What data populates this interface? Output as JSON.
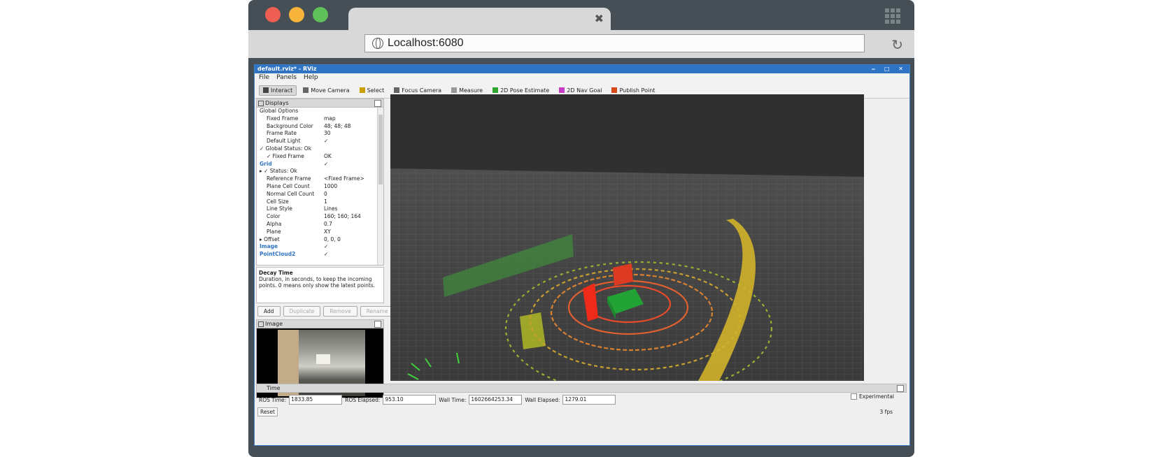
{
  "browser": {
    "address": "Localhost:6080",
    "tab_close": "✖",
    "reload": "↻"
  },
  "rviz": {
    "title": "default.rviz* - RViz",
    "window_buttons": "‒ □ ✕",
    "menu": [
      "File",
      "Panels",
      "Help"
    ],
    "toolbar": [
      {
        "label": "Interact",
        "icon": "hand-icon",
        "color": "#444"
      },
      {
        "label": "Move Camera",
        "icon": "move-camera-icon",
        "color": "#666"
      },
      {
        "label": "Select",
        "icon": "select-icon",
        "color": "#c8a000"
      },
      {
        "label": "Focus Camera",
        "icon": "focus-camera-icon",
        "color": "#666"
      },
      {
        "label": "Measure",
        "icon": "measure-icon",
        "color": "#999"
      },
      {
        "label": "2D Pose Estimate",
        "icon": "pose-estimate-icon",
        "color": "#2fa52f"
      },
      {
        "label": "2D Nav Goal",
        "icon": "nav-goal-icon",
        "color": "#c83cc8"
      },
      {
        "label": "Publish Point",
        "icon": "publish-point-icon",
        "color": "#d94a1a"
      }
    ],
    "displays": {
      "header": "Displays",
      "rows": [
        {
          "k": "Global Options",
          "v": "",
          "indent": 4,
          "color": "#222"
        },
        {
          "k": "Fixed Frame",
          "v": "map",
          "indent": 14,
          "color": "#222"
        },
        {
          "k": "Background Color",
          "v": "48; 48; 48",
          "indent": 14,
          "color": "#222"
        },
        {
          "k": "Frame Rate",
          "v": "30",
          "indent": 14,
          "color": "#222"
        },
        {
          "k": "Default Light",
          "v": "✓",
          "indent": 14,
          "color": "#222"
        },
        {
          "k": "✓ Global Status: Ok",
          "v": "",
          "indent": 4,
          "color": "#222"
        },
        {
          "k": "✓ Fixed Frame",
          "v": "OK",
          "indent": 14,
          "color": "#222"
        },
        {
          "k": "Grid",
          "v": "✓",
          "indent": 4,
          "color": "#2f73c4"
        },
        {
          "k": "▸ ✓ Status: Ok",
          "v": "",
          "indent": 4,
          "color": "#222"
        },
        {
          "k": "Reference Frame",
          "v": "<Fixed Frame>",
          "indent": 14,
          "color": "#222"
        },
        {
          "k": "Plane Cell Count",
          "v": "1000",
          "indent": 14,
          "color": "#222"
        },
        {
          "k": "Normal Cell Count",
          "v": "0",
          "indent": 14,
          "color": "#222"
        },
        {
          "k": "Cell Size",
          "v": "1",
          "indent": 14,
          "color": "#222"
        },
        {
          "k": "Line Style",
          "v": "Lines",
          "indent": 14,
          "color": "#222"
        },
        {
          "k": "Color",
          "v": "160; 160; 164",
          "indent": 14,
          "color": "#222"
        },
        {
          "k": "Alpha",
          "v": "0.7",
          "indent": 14,
          "color": "#222"
        },
        {
          "k": "Plane",
          "v": "XY",
          "indent": 14,
          "color": "#222"
        },
        {
          "k": "▸ Offset",
          "v": "0, 0, 0",
          "indent": 4,
          "color": "#222"
        },
        {
          "k": "Image",
          "v": "✓",
          "indent": 4,
          "color": "#2f73c4"
        },
        {
          "k": "PointCloud2",
          "v": "✓",
          "indent": 4,
          "color": "#2f73c4"
        }
      ],
      "desc_title": "Decay Time",
      "desc_text": "Duration, in seconds, to keep the incoming points. 0 means only show the latest points.",
      "buttons": {
        "add": "Add",
        "duplicate": "Duplicate",
        "remove": "Remove",
        "rename": "Rename"
      }
    },
    "image_panel": {
      "header": "Image"
    },
    "time": {
      "header": "Time",
      "ros_time_label": "ROS Time:",
      "ros_time": "1833.85",
      "ros_elapsed_label": "ROS Elapsed:",
      "ros_elapsed": "953.10",
      "wall_time_label": "Wall Time:",
      "wall_time": "1602664253.34",
      "wall_elapsed_label": "Wall Elapsed:",
      "wall_elapsed": "1279.01",
      "experimental": "Experimental",
      "reset": "Reset",
      "fps": "3 fps"
    }
  }
}
